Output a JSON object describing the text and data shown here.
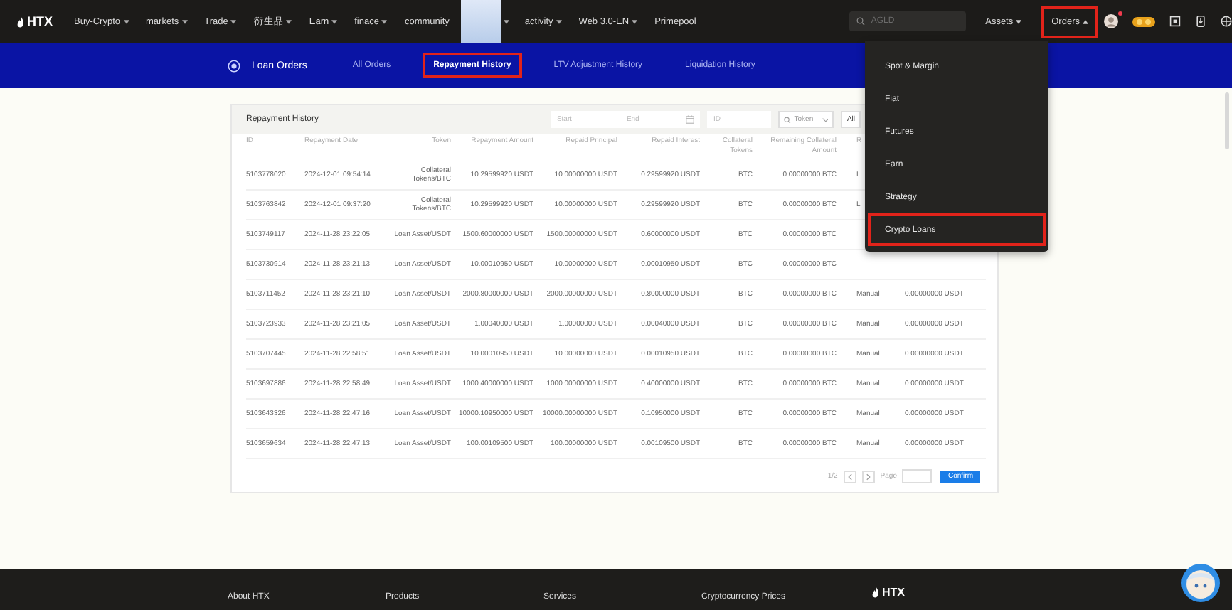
{
  "nav": {
    "logo": "HTX",
    "items": [
      {
        "kind": "link",
        "label": "Buy-Crypto",
        "has_menu": true
      },
      {
        "kind": "link",
        "label": "markets",
        "has_menu": true
      },
      {
        "kind": "link",
        "label": "Trade",
        "has_menu": true
      },
      {
        "kind": "link",
        "label": "衍生品",
        "has_menu": true
      },
      {
        "kind": "link",
        "label": "Earn",
        "has_menu": true
      },
      {
        "kind": "link",
        "label": "finace",
        "has_menu": true
      },
      {
        "kind": "link",
        "label": "community",
        "has_menu": false
      },
      {
        "kind": "mascot",
        "has_menu": true
      },
      {
        "kind": "link",
        "label": "activity",
        "has_menu": true
      },
      {
        "kind": "link",
        "label": "Web 3.0-EN",
        "has_menu": true
      },
      {
        "kind": "link",
        "label": "Primepool",
        "has_menu": false
      }
    ],
    "search": {
      "placeholder": "AGLD"
    },
    "menus": [
      {
        "label": "Assets",
        "expanded": false,
        "highlighted": false
      },
      {
        "label": "Orders",
        "expanded": true,
        "highlighted": true
      }
    ],
    "notification_dot": true
  },
  "subnav": {
    "title": "Loan Orders",
    "tabs": [
      {
        "label": "All Orders",
        "selected": false,
        "highlighted": false
      },
      {
        "label": "Repayment History",
        "selected": true,
        "highlighted": true
      },
      {
        "label": "LTV Adjustment History",
        "selected": false,
        "highlighted": false
      },
      {
        "label": "Liquidation History",
        "selected": false,
        "highlighted": false
      }
    ]
  },
  "table": {
    "title": "Repayment History",
    "filters": {
      "start_placeholder": "Start",
      "range_separator": "—",
      "end_placeholder": "End",
      "id_placeholder": "ID",
      "token_placeholder": "Token",
      "all_button": "All"
    },
    "columns": [
      "ID",
      "Repayment Date",
      "Token",
      "Repayment Amount",
      "Repaid Principal",
      "Repaid Interest",
      "Collateral Tokens",
      "Remaining Collateral Amount",
      "R"
    ],
    "rows": [
      [
        "5103778020",
        "2024-12-01 09:54:14",
        "Collateral Tokens/BTC",
        "10.29599920 USDT",
        "10.00000000 USDT",
        "0.29599920 USDT",
        "BTC",
        "0.00000000 BTC",
        "L"
      ],
      [
        "5103763842",
        "2024-12-01 09:37:20",
        "Collateral Tokens/BTC",
        "10.29599920 USDT",
        "10.00000000 USDT",
        "0.29599920 USDT",
        "BTC",
        "0.00000000 BTC",
        "L"
      ],
      [
        "5103749117",
        "2024-11-28 23:22:05",
        "Loan Asset/USDT",
        "1500.60000000 USDT",
        "1500.00000000 USDT",
        "0.60000000 USDT",
        "BTC",
        "0.00000000 BTC"
      ],
      [
        "5103730914",
        "2024-11-28 23:21:13",
        "Loan Asset/USDT",
        "10.00010950 USDT",
        "10.00000000 USDT",
        "0.00010950 USDT",
        "BTC",
        "0.00000000 BTC"
      ],
      [
        "5103711452",
        "2024-11-28 23:21:10",
        "Loan Asset/USDT",
        "2000.80000000 USDT",
        "2000.00000000 USDT",
        "0.80000000 USDT",
        "BTC",
        "0.00000000 BTC",
        "Manual",
        "0.00000000 USDT"
      ],
      [
        "5103723933",
        "2024-11-28 23:21:05",
        "Loan Asset/USDT",
        "1.00040000 USDT",
        "1.00000000 USDT",
        "0.00040000 USDT",
        "BTC",
        "0.00000000 BTC",
        "Manual",
        "0.00000000 USDT"
      ],
      [
        "5103707445",
        "2024-11-28 22:58:51",
        "Loan Asset/USDT",
        "10.00010950 USDT",
        "10.00000000 USDT",
        "0.00010950 USDT",
        "BTC",
        "0.00000000 BTC",
        "Manual",
        "0.00000000 USDT"
      ],
      [
        "5103697886",
        "2024-11-28 22:58:49",
        "Loan Asset/USDT",
        "1000.40000000 USDT",
        "1000.00000000 USDT",
        "0.40000000 USDT",
        "BTC",
        "0.00000000 BTC",
        "Manual",
        "0.00000000 USDT"
      ],
      [
        "5103643326",
        "2024-11-28 22:47:16",
        "Loan Asset/USDT",
        "10000.10950000 USDT",
        "10000.00000000 USDT",
        "0.10950000 USDT",
        "BTC",
        "0.00000000 BTC",
        "Manual",
        "0.00000000 USDT"
      ],
      [
        "5103659634",
        "2024-11-28 22:47:13",
        "Loan Asset/USDT",
        "100.00109500 USDT",
        "100.00000000 USDT",
        "0.00109500 USDT",
        "BTC",
        "0.00000000 BTC",
        "Manual",
        "0.00000000 USDT"
      ]
    ],
    "pagination": {
      "page_indicator": "1/2",
      "page_label": "Page",
      "confirm_button": "Confirm"
    }
  },
  "orders_menu": [
    {
      "label": "Spot & Margin",
      "highlighted": false
    },
    {
      "label": "Fiat",
      "highlighted": false
    },
    {
      "label": "Futures",
      "highlighted": false
    },
    {
      "label": "Earn",
      "highlighted": false
    },
    {
      "label": "Strategy",
      "highlighted": false
    },
    {
      "label": "Crypto Loans",
      "highlighted": true
    }
  ],
  "footer": {
    "columns": [
      "About HTX",
      "Products",
      "Services",
      "Cryptocurrency Prices"
    ],
    "logo": "HTX"
  }
}
